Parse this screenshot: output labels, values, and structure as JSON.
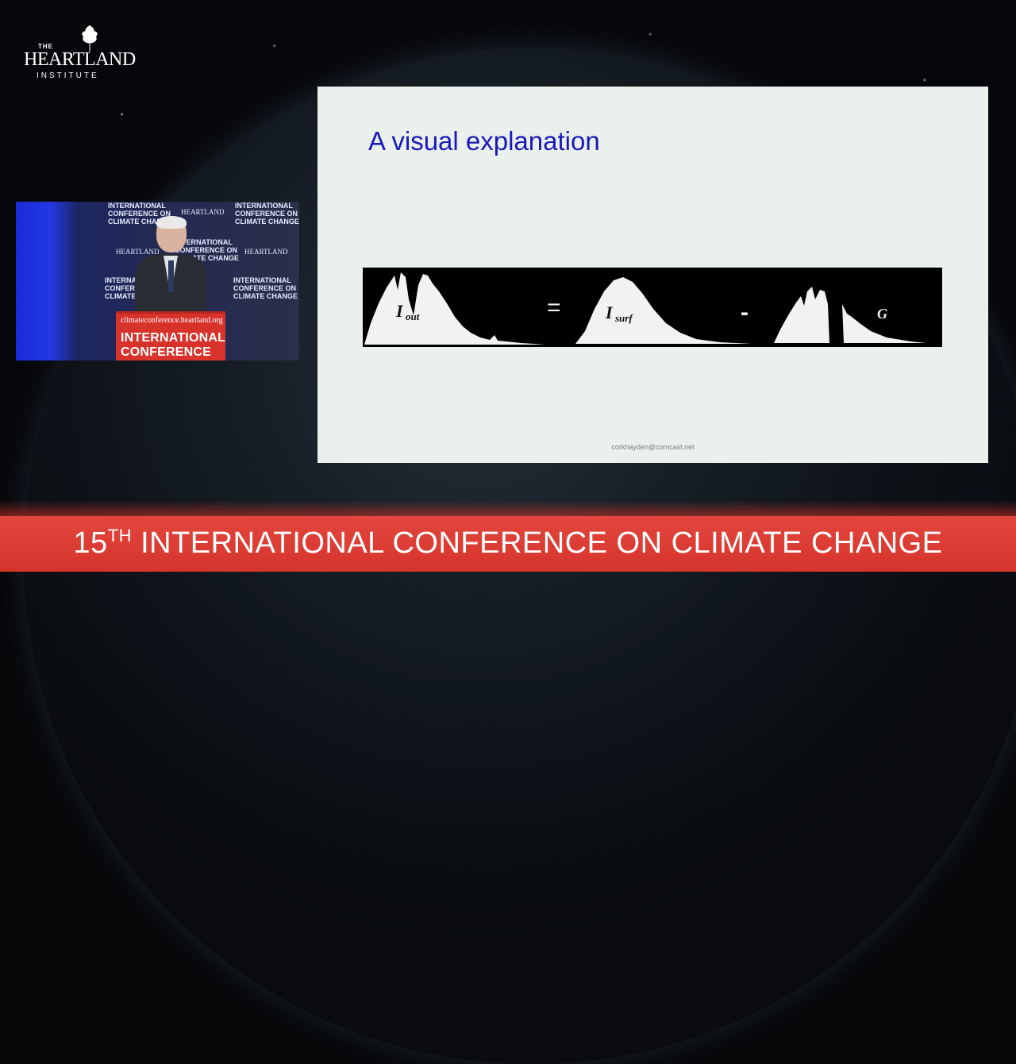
{
  "logo": {
    "the": "THE",
    "name": "HEARTLAND",
    "sub": "INSTITUTE"
  },
  "video": {
    "backdrop": [
      "INTERNATIONAL",
      "CONFERENCE ON",
      "CLIMATE CHANGE"
    ],
    "backdrop_logo": "HEARTLAND",
    "podium_url": "climateconference.heartland.org",
    "podium_line1": "INTERNATIONAL",
    "podium_line2": "CONFERENCE ON"
  },
  "slide": {
    "title": "A visual explanation",
    "labels": {
      "i_out": "I",
      "i_out_sub": "out",
      "equals": "=",
      "i_surf": "I",
      "i_surf_sub": "surf",
      "minus": "-",
      "g": "G"
    },
    "email": "corkhayden@comcast.net"
  },
  "banner": {
    "number": "15",
    "suffix": "TH",
    "text": "INTERNATIONAL CONFERENCE ON CLIMATE CHANGE"
  },
  "colors": {
    "slide_title": "#1a1ab8",
    "banner": "#d6342c",
    "slide_bg": "#eaf0ec"
  }
}
